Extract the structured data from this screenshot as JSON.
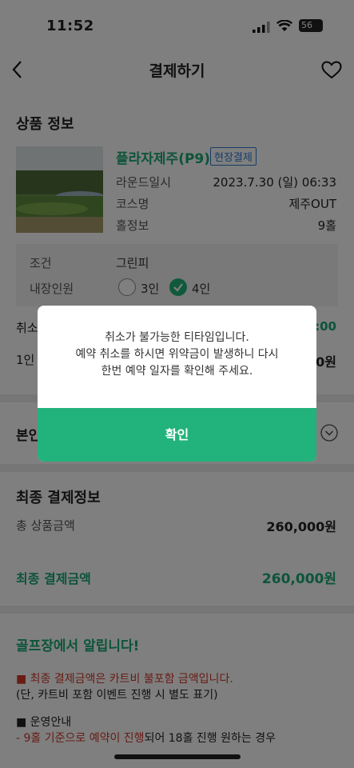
{
  "status": {
    "time": "11:52",
    "battery": "56"
  },
  "header": {
    "title": "결제하기"
  },
  "product": {
    "section_title": "상품 정보",
    "name": "플라자제주(P9)",
    "badge": "현장결제",
    "rows": [
      {
        "label": "라운드일시",
        "value": "2023.7.30 (일) 06:33"
      },
      {
        "label": "코스명",
        "value": "제주OUT"
      },
      {
        "label": "홀정보",
        "value": "9홀"
      }
    ],
    "condition_label": "조건",
    "condition_value": "그린피",
    "players_label": "내장인원",
    "option_3": "3인",
    "option_4": "4인"
  },
  "partial": {
    "cancel_label": "취소",
    "cancel_value": ":00",
    "per_label": "1인",
    "per_value": "0원",
    "self_label": "본인"
  },
  "final": {
    "section_title": "최종 결제정보",
    "total_label": "총 상품금액",
    "total_value": "260,000원",
    "final_label": "최종 결제금액",
    "final_value": "260,000원"
  },
  "notice": {
    "title": "골프장에서 알립니다!",
    "line1": "■ 최종 결제금액은 카트비 불포함 금액입니다.",
    "line2": "(단, 카트비 포함 이벤트 진행 시 별도 표기)",
    "line3": "■ 운영안내",
    "line4_red": "- 9홀 기준으로 예약이 진행",
    "line4_black": "되어 18홀 진행 원하는 경우"
  },
  "modal": {
    "line1": "취소가 불가능한 티타임입니다.",
    "line2": "예약 취소를 하시면 위약금이 발생하니 다시",
    "line3": "한번 예약 일자를 확인해 주세요.",
    "confirm": "확인"
  },
  "colors": {
    "accent": "#22b27b",
    "badge": "#2a7bd0",
    "notice_red": "#d0392b"
  }
}
